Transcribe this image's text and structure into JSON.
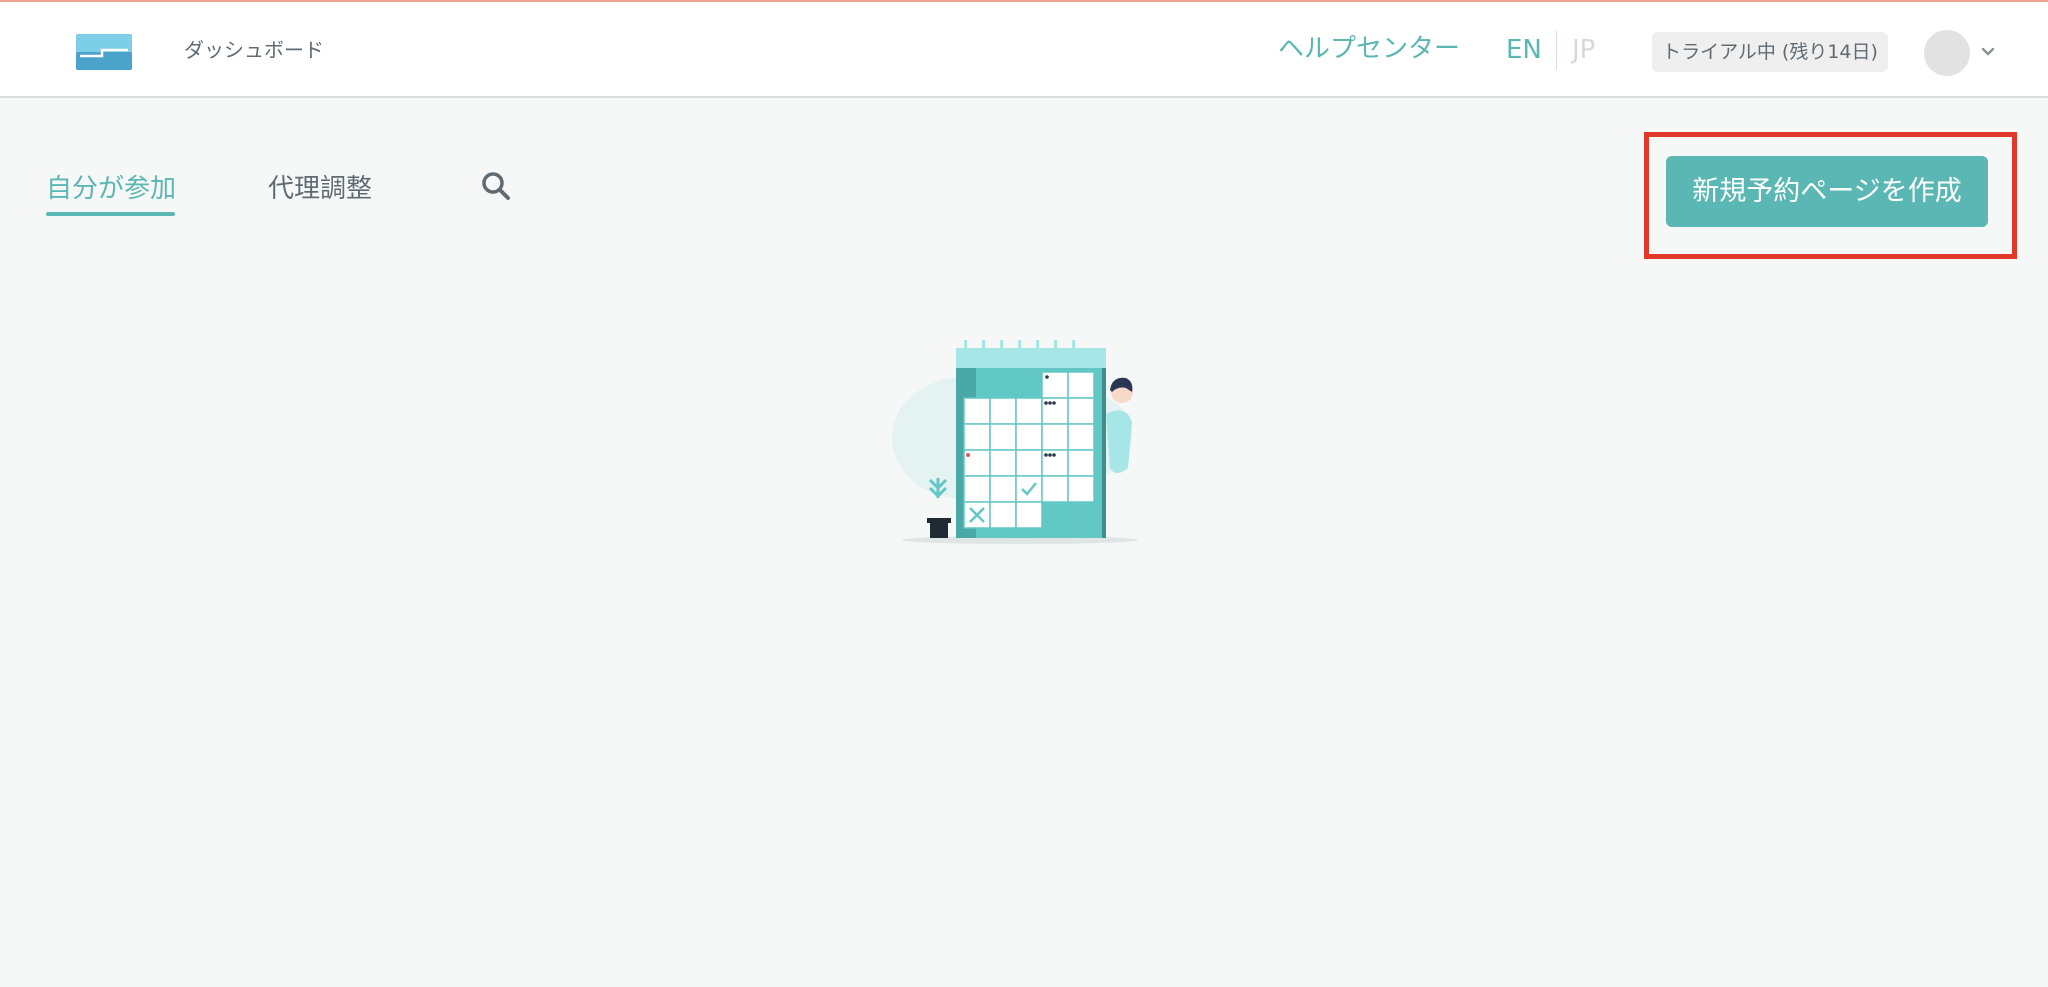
{
  "header": {
    "title": "ダッシュボード",
    "help_center": "ヘルプセンター",
    "lang_en": "EN",
    "lang_jp": "JP",
    "trial_badge": "トライアル中 (残り14日)"
  },
  "tabs": {
    "mine": "自分が参加",
    "proxy": "代理調整"
  },
  "actions": {
    "create_button": "新規予約ページを作成"
  },
  "icons": {
    "logo": "app-logo-icon",
    "search": "search-icon",
    "chevron": "chevron-down-icon",
    "avatar": "avatar"
  },
  "colors": {
    "accent": "#5ab7b3",
    "text": "#5f6b73",
    "highlight": "#e0382a"
  }
}
